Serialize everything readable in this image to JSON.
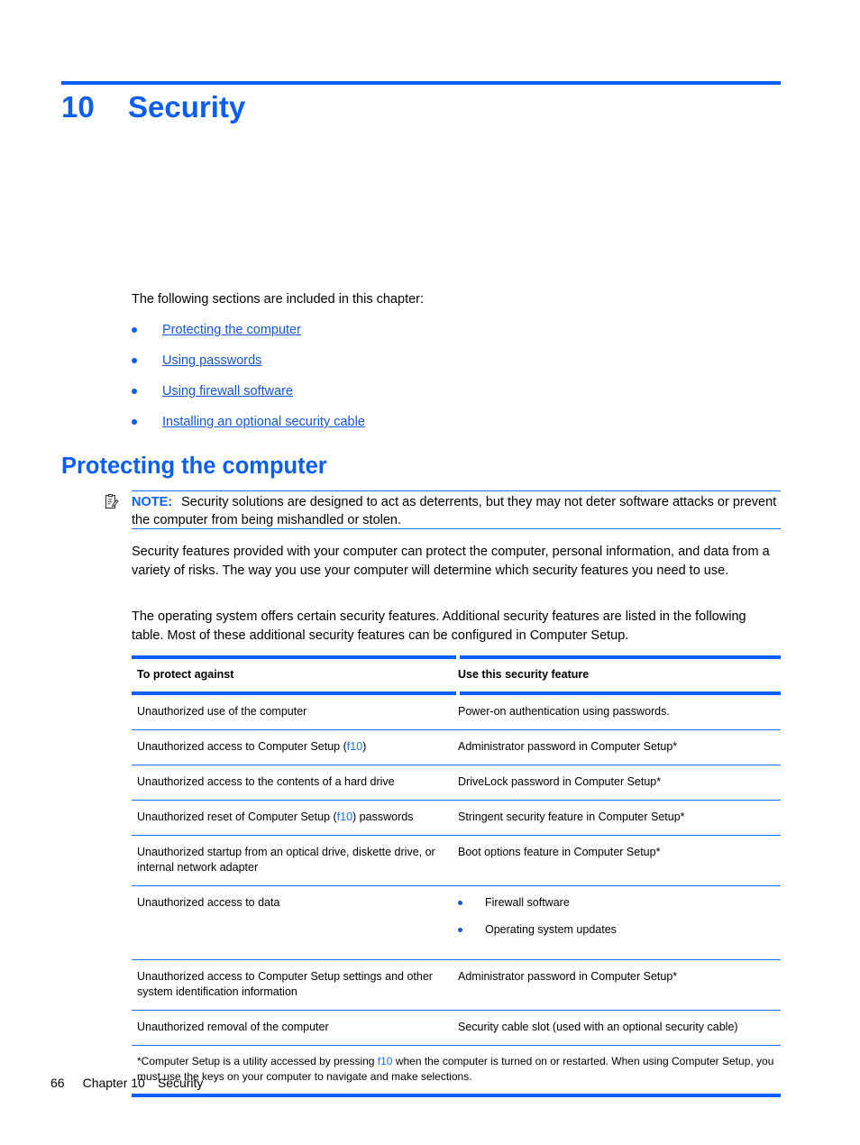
{
  "chapter": {
    "number": "10",
    "title": "Security"
  },
  "intro": {
    "text": "The following sections are included in this chapter:"
  },
  "toc": {
    "items": [
      {
        "label": "Protecting the computer"
      },
      {
        "label": "Using passwords"
      },
      {
        "label": "Using firewall software"
      },
      {
        "label": "Installing an optional security cable"
      }
    ]
  },
  "section": {
    "heading": "Protecting the computer"
  },
  "note": {
    "icon": "note-clipboard-icon",
    "label": "NOTE:",
    "text": "Security solutions are designed to act as deterrents, but they may not deter software attacks or prevent the computer from being mishandled or stolen."
  },
  "paragraphs": {
    "p1": "Security features provided with your computer can protect the computer, personal information, and data from a variety of risks. The way you use your computer will determine which security features you need to use.",
    "p2": "The operating system offers certain security features. Additional security features are listed in the following table. Most of these additional security features can be configured in Computer Setup."
  },
  "table": {
    "headers": {
      "col_a": "To protect against",
      "col_b": "Use this security feature"
    },
    "rows": [
      {
        "protect_against": "Unauthorized use of the computer",
        "feature": "Power-on authentication using passwords."
      },
      {
        "protect_against_pre": "Unauthorized access to Computer Setup (",
        "protect_against_key": "f10",
        "protect_against_post": ")",
        "feature": "Administrator password in Computer Setup*"
      },
      {
        "protect_against": "Unauthorized access to the contents of a hard drive",
        "feature": "DriveLock password in Computer Setup*"
      },
      {
        "protect_against_pre": "Unauthorized reset of Computer Setup (",
        "protect_against_key": "f10",
        "protect_against_post": ") passwords",
        "feature": "Stringent security feature in Computer Setup*"
      },
      {
        "protect_against": "Unauthorized startup from an optical drive, diskette drive, or internal network adapter",
        "feature": "Boot options feature in Computer Setup*"
      },
      {
        "protect_against": "Unauthorized access to data",
        "feature_bullets": [
          "Firewall software",
          "Operating system updates"
        ]
      },
      {
        "protect_against": "Unauthorized access to Computer Setup settings and other system identification information",
        "feature": "Administrator password in Computer Setup*"
      },
      {
        "protect_against": "Unauthorized removal of the computer",
        "feature": "Security cable slot (used with an optional security cable)"
      }
    ],
    "footnote_pre": "*Computer Setup is a utility accessed by pressing ",
    "footnote_key": "f10",
    "footnote_post": " when the computer is turned on or restarted. When using Computer Setup, you must use the keys on your computer to navigate and make selections."
  },
  "footer": {
    "page_number": "66",
    "chapter_label": "Chapter 10",
    "chapter_name": "Security"
  },
  "colors": {
    "accent_blue": "#0a5df5",
    "link_blue": "#1457d4",
    "rule_blue": "#1a6ef0"
  }
}
